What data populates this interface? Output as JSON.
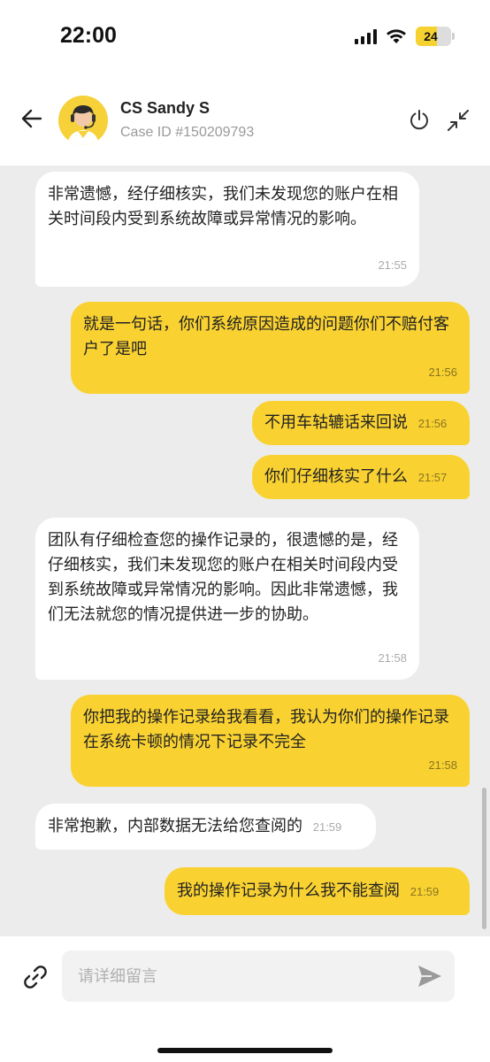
{
  "status_bar": {
    "time": "22:00",
    "battery": "24",
    "icons": [
      "cellular-signal-icon",
      "wifi-icon",
      "battery-icon"
    ]
  },
  "header": {
    "agent_name": "CS Sandy S",
    "case_id": "Case ID #150209793",
    "icons": [
      "back-arrow-icon",
      "avatar",
      "power-icon",
      "collapse-icon"
    ]
  },
  "colors": {
    "accent": "#f9d232",
    "chat_background": "#ececec",
    "incoming_bubble": "#ffffff"
  },
  "messages": [
    {
      "sender": "agent",
      "text": "非常遗憾，经仔细核实，我们未发现您的账户在相关时间段内受到系统故障或异常情况的影响。",
      "time": "21:55"
    },
    {
      "sender": "user",
      "text": "就是一句话，你们系统原因造成的问题你们不赔付客户了是吧",
      "time": "21:56"
    },
    {
      "sender": "user",
      "text": "不用车轱辘话来回说",
      "time": "21:56"
    },
    {
      "sender": "user",
      "text": "你们仔细核实了什么",
      "time": "21:57"
    },
    {
      "sender": "agent",
      "text": "团队有仔细检查您的操作记录的，很遗憾的是，经仔细核实，我们未发现您的账户在相关时间段内受到系统故障或异常情况的影响。因此非常遗憾，我们无法就您的情况提供进一步的协助。",
      "time": "21:58"
    },
    {
      "sender": "user",
      "text": "你把我的操作记录给我看看，我认为你们的操作记录在系统卡顿的情况下记录不完全",
      "time": "21:58"
    },
    {
      "sender": "agent",
      "text": "非常抱歉，内部数据无法给您查阅的",
      "time": "21:59"
    },
    {
      "sender": "user",
      "text": "我的操作记录为什么我不能查阅",
      "time": "21:59"
    }
  ],
  "input": {
    "placeholder": "请详细留言",
    "value": "",
    "icons": [
      "attachment-link-icon",
      "send-icon"
    ]
  }
}
